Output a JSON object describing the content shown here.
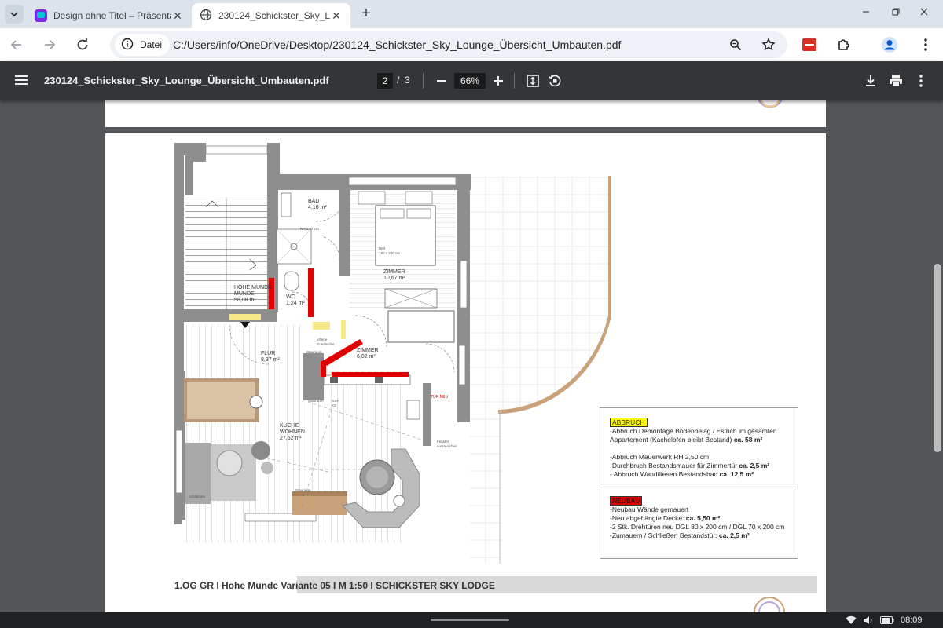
{
  "browser": {
    "tabs": [
      {
        "title": "Design ohne Titel – Präsenta",
        "icon": "canva-icon",
        "active": false
      },
      {
        "title": "230124_Schickster_Sky_Loun",
        "icon": "globe-icon",
        "active": true
      }
    ],
    "address": {
      "security_chip": "Datei",
      "url": "C:/Users/info/OneDrive/Desktop/230124_Schickster_Sky_Lounge_Übersicht_Umbauten.pdf"
    }
  },
  "pdf_toolbar": {
    "filename": "230124_Schickster_Sky_Lounge_Übersicht_Umbauten.pdf",
    "current_page": "2",
    "page_separator": "/",
    "total_pages": "3",
    "zoom": "66%"
  },
  "floorplan": {
    "rooms": [
      {
        "name": "BAD",
        "area": "4,16 m²"
      },
      {
        "name": "ZIMMER",
        "area": "10,67 m²"
      },
      {
        "name": "HOHE MUNDE",
        "area": "58,08 m²"
      },
      {
        "name": "WC",
        "area": "1,24 m²"
      },
      {
        "name": "FLUR",
        "area": "8,37 m²"
      },
      {
        "name": "ZIMMER",
        "area": "6,02 m²"
      },
      {
        "name": "KÜCHE",
        "name2": "WOHNEN",
        "area": "27,62 m²"
      }
    ],
    "small_labels": {
      "rh": "RH 2,07 cm",
      "bett": "Bett",
      "bett_size": "180 x 200 cm",
      "offene": "offene",
      "garderobe": "Garderobe",
      "stauraum1": "Stauraum",
      "stauraum2": "Stauraum",
      "gsp": "GSP",
      "ks": "KS",
      "tuer_neu": "TÜR NEU",
      "fenster": "Fenster",
      "austauschen": "austauschen",
      "schlafsofa": "Schlafsofa",
      "stauraum3": "Stauraum"
    },
    "caption": "1.OG GR I Hohe Munde Variante 05 I M 1:50 I SCHICKSTER SKY LODGE"
  },
  "legend": {
    "abbruch_label": "ABBRUCH",
    "abbruch_lines": [
      {
        "text": "-Abbruch Demontage Bodenbelag / Estrich im gesamten",
        "bold": ""
      },
      {
        "text": "Appartement (Kachelofen bleibt Bestand) ",
        "bold": "ca. 58 m²"
      },
      {
        "text": "",
        "bold": ""
      },
      {
        "text": "-Abbruch Mauerwerk RH 2,50 cm",
        "bold": ""
      },
      {
        "text": "-Durchbruch Bestandsmauer für Zimmertür ",
        "bold": "ca. 2,5 m²"
      },
      {
        "text": "- Abbruch Wandfliesen Bestandsbad ",
        "bold": "ca. 12,5 m²"
      }
    ],
    "neubau_label": "NEUBAU",
    "neubau_lines": [
      {
        "text": "-Neubau Wände gemauert",
        "bold": ""
      },
      {
        "text": "-Neu abgehängte Decke: ",
        "bold": "ca. 5,50 m²"
      },
      {
        "text": "-2 Stk. Drehtüren neu DGL 80 x 200 cm / DGL 70 x 200 cm",
        "bold": ""
      },
      {
        "text": "-Zumauern / Schließen Bestandstür: ",
        "bold": "ca. 2,5 m²"
      }
    ]
  },
  "shelf": {
    "time": "08:09"
  },
  "colors": {
    "tabstrip": "#dde3ea",
    "pdf_toolbar": "#323639",
    "viewer_bg": "#525659",
    "abbruch": "#ffff00",
    "neubau": "#e00000",
    "wall": "#8e8e8e"
  }
}
